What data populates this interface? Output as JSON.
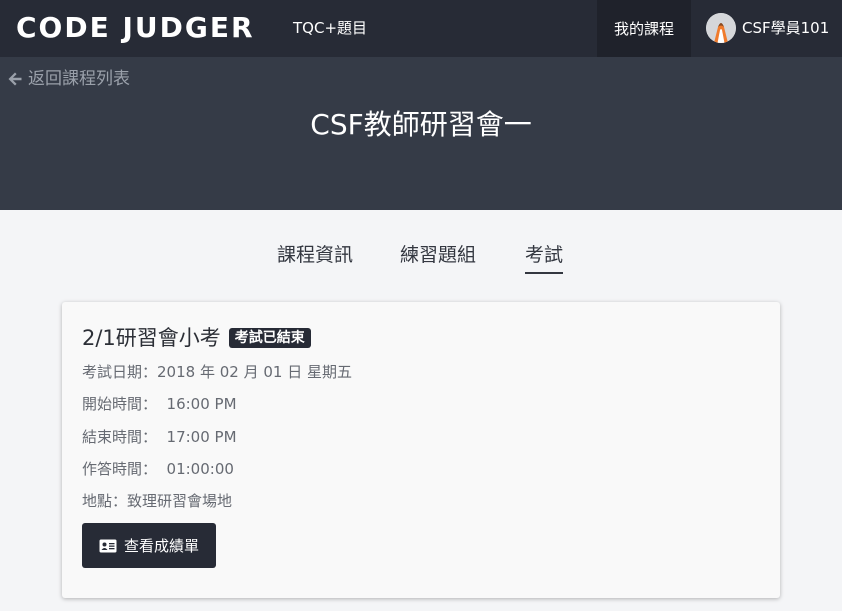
{
  "navbar": {
    "brand": "CODE JUDGER",
    "link": "TQC+題目",
    "active_link": "我的課程",
    "user_name": "CSF學員101"
  },
  "header": {
    "back_label": "返回課程列表",
    "course_title": "CSF教師研習會一"
  },
  "tabs": [
    {
      "label": "課程資訊",
      "active": false
    },
    {
      "label": "練習題組",
      "active": false
    },
    {
      "label": "考試",
      "active": true
    }
  ],
  "exam": {
    "title": "2/1研習會小考",
    "status_badge": "考試已結束",
    "date": "考試日期：2018 年 02 月 01 日 星期五",
    "start_time": "開始時間：  16:00 PM",
    "end_time": "結束時間：  17:00 PM",
    "duration": "作答時間：  01:00:00",
    "location": "地點：致理研習會場地",
    "view_scores_label": "查看成績單"
  },
  "colors": {
    "navbar_bg": "#272b36",
    "hero_bg": "#353b47",
    "accent_dark": "#272b36",
    "page_bg": "#f4f5f7"
  },
  "icons": {
    "back": "arrow-left-icon",
    "avatar": "user-avatar-icon",
    "scores": "id-card-icon"
  }
}
